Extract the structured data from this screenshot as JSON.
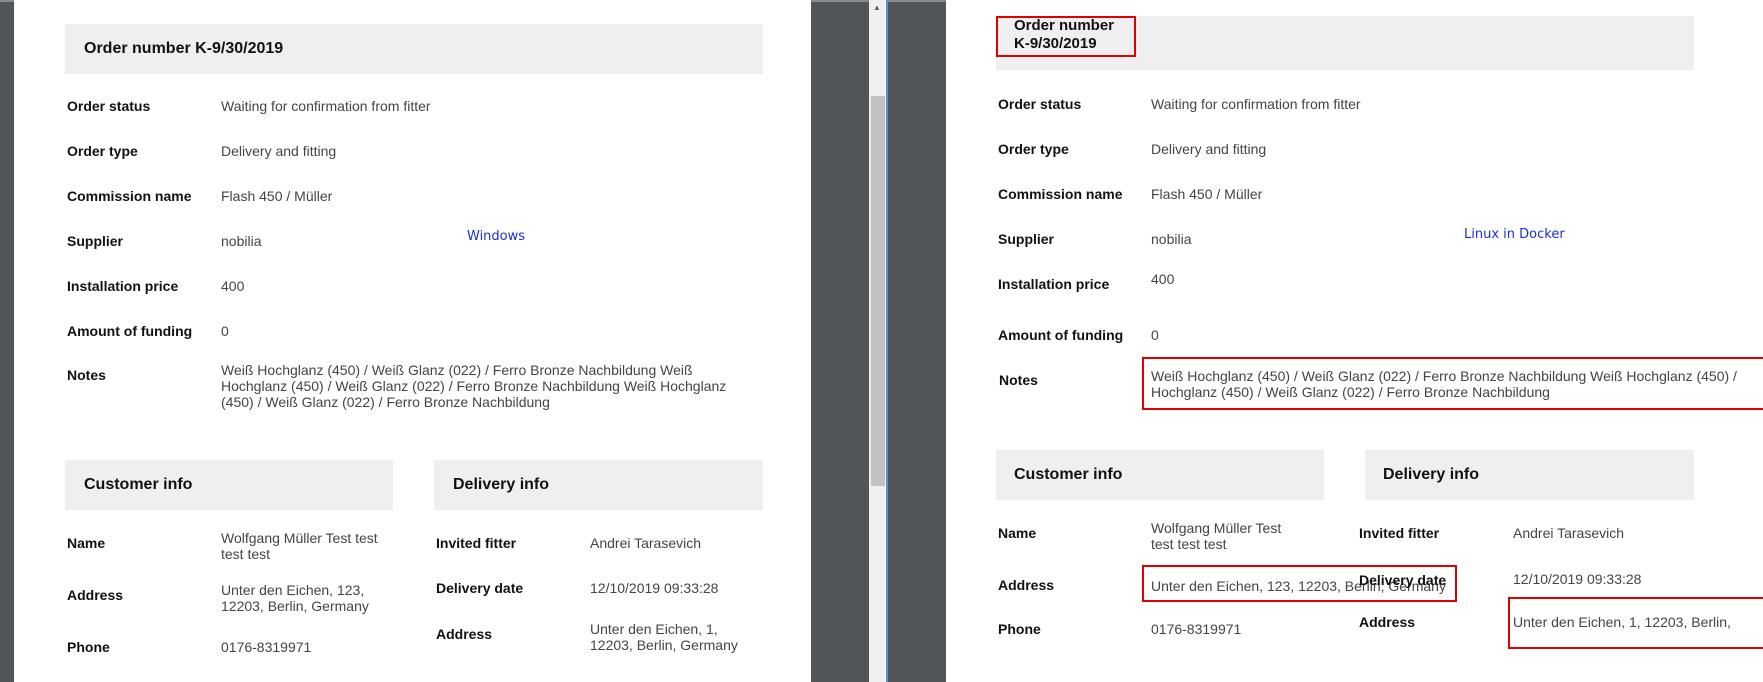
{
  "left": {
    "environment_label": "Windows",
    "order_header": "Order number K-9/30/2019",
    "fields": [
      {
        "label": "Order status",
        "value": "Waiting for confirmation from fitter"
      },
      {
        "label": "Order type",
        "value": "Delivery and fitting"
      },
      {
        "label": "Commission name",
        "value": "Flash 450 / Müller"
      },
      {
        "label": "Supplier",
        "value": "nobilia"
      },
      {
        "label": "Installation price",
        "value": "400"
      },
      {
        "label": "Amount of funding",
        "value": "0"
      },
      {
        "label": "Notes",
        "lines": [
          "Weiß Hochglanz (450) / Weiß Glanz (022) / Ferro Bronze Nachbildung Weiß",
          "Hochglanz (450) / Weiß Glanz (022) / Ferro Bronze Nachbildung Weiß Hochglanz",
          "(450) / Weiß Glanz (022) / Ferro Bronze Nachbildung"
        ]
      }
    ],
    "customer_header": "Customer info",
    "customer": [
      {
        "label": "Name",
        "lines": [
          "Wolfgang Müller Test test",
          "test test"
        ]
      },
      {
        "label": "Address",
        "lines": [
          "Unter den Eichen, 123,",
          "12203, Berlin, Germany"
        ]
      },
      {
        "label": "Phone",
        "lines": [
          "0176-8319971"
        ]
      }
    ],
    "delivery_header": "Delivery info",
    "delivery": [
      {
        "label": "Invited fitter",
        "lines": [
          "Andrei Tarasevich"
        ]
      },
      {
        "label": "Delivery date",
        "lines": [
          "12/10/2019 09:33:28"
        ]
      },
      {
        "label": "Address",
        "lines": [
          "Unter den Eichen, 1,",
          "12203, Berlin, Germany"
        ]
      }
    ]
  },
  "right": {
    "environment_label": "Linux in Docker",
    "order_header_lines": [
      "Order number",
      "K-9/30/2019"
    ],
    "fields": [
      {
        "label": "Order status",
        "value": "Waiting for confirmation from fitter"
      },
      {
        "label": "Order type",
        "value": "Delivery and fitting"
      },
      {
        "label": "Commission name",
        "value": "Flash 450 / Müller"
      },
      {
        "label": "Supplier",
        "value": "nobilia"
      },
      {
        "label": "Installation price",
        "value": "400"
      },
      {
        "label": "Amount of funding",
        "value": "0"
      },
      {
        "label": "Notes",
        "lines": [
          "Weiß Hochglanz (450) / Weiß Glanz (022) / Ferro Bronze Nachbildung Weiß Hochglanz (450) /",
          "Hochglanz (450) / Weiß Glanz (022) / Ferro Bronze Nachbildung"
        ]
      }
    ],
    "customer_header": "Customer info",
    "customer": [
      {
        "label": "Name",
        "lines": [
          "Wolfgang Müller Test",
          "test test test"
        ]
      },
      {
        "label": "Address",
        "lines": [
          "Unter den Eichen, 123, 12203, Berlin, Germany"
        ]
      },
      {
        "label": "Phone",
        "lines": [
          "0176-8319971"
        ]
      }
    ],
    "delivery_header": "Delivery info",
    "delivery": [
      {
        "label": "Invited fitter",
        "lines": [
          "Andrei Tarasevich"
        ]
      },
      {
        "label": "Delivery date",
        "lines": [
          "12/10/2019 09:33:28"
        ]
      },
      {
        "label": "Address",
        "lines": [
          "Unter den Eichen, 1, 12203, Berlin,"
        ]
      }
    ]
  },
  "scrollbar": {
    "up_arrow_icon": "triangle-up-icon"
  },
  "colors": {
    "background": "#51565b",
    "page": "#ffffff",
    "header_band": "#efefef",
    "highlight": "#e00000",
    "environment_label": "#1c2fd0",
    "splitter": "#5b8fd0"
  }
}
